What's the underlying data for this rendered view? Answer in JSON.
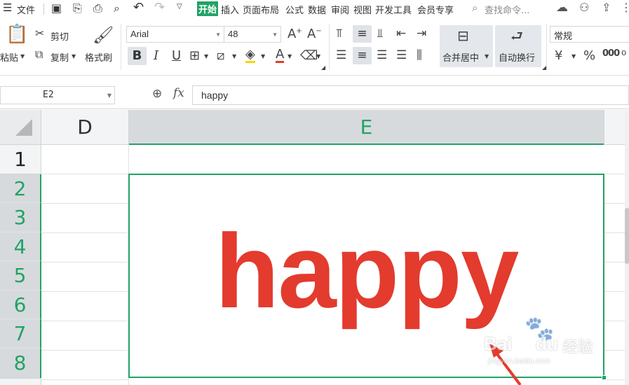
{
  "menubar": {
    "file": "文件",
    "tabs": [
      "开始",
      "插入",
      "页面布局",
      "公式",
      "数据",
      "审阅",
      "视图",
      "开发工具",
      "会员专享"
    ],
    "search_placeholder": "查找命令..."
  },
  "ribbon": {
    "paste": "粘贴",
    "cut": "剪切",
    "copy": "复制",
    "format_painter": "格式刷",
    "font_name": "Arial",
    "font_size": "48",
    "merge_center": "合并居中",
    "wrap_text": "自动换行",
    "number_format": "常规",
    "bold": "B",
    "italic": "I",
    "underline": "U",
    "font_color_letter": "A",
    "currency": "¥",
    "percent": "%",
    "thousands": "000"
  },
  "formula_bar": {
    "cell_ref": "E2",
    "fx": "fx",
    "content": "happy"
  },
  "grid": {
    "columns": [
      "D",
      "E"
    ],
    "rows": [
      "1",
      "2",
      "3",
      "4",
      "5",
      "6",
      "7",
      "8"
    ],
    "cell_text": "happy",
    "cell_color": "#e33b2e",
    "selection_color": "#21a366"
  },
  "watermark": {
    "brand": "Bai",
    "brand2": "du",
    "suffix": "经验",
    "url": "jingyan.baidu.com"
  }
}
